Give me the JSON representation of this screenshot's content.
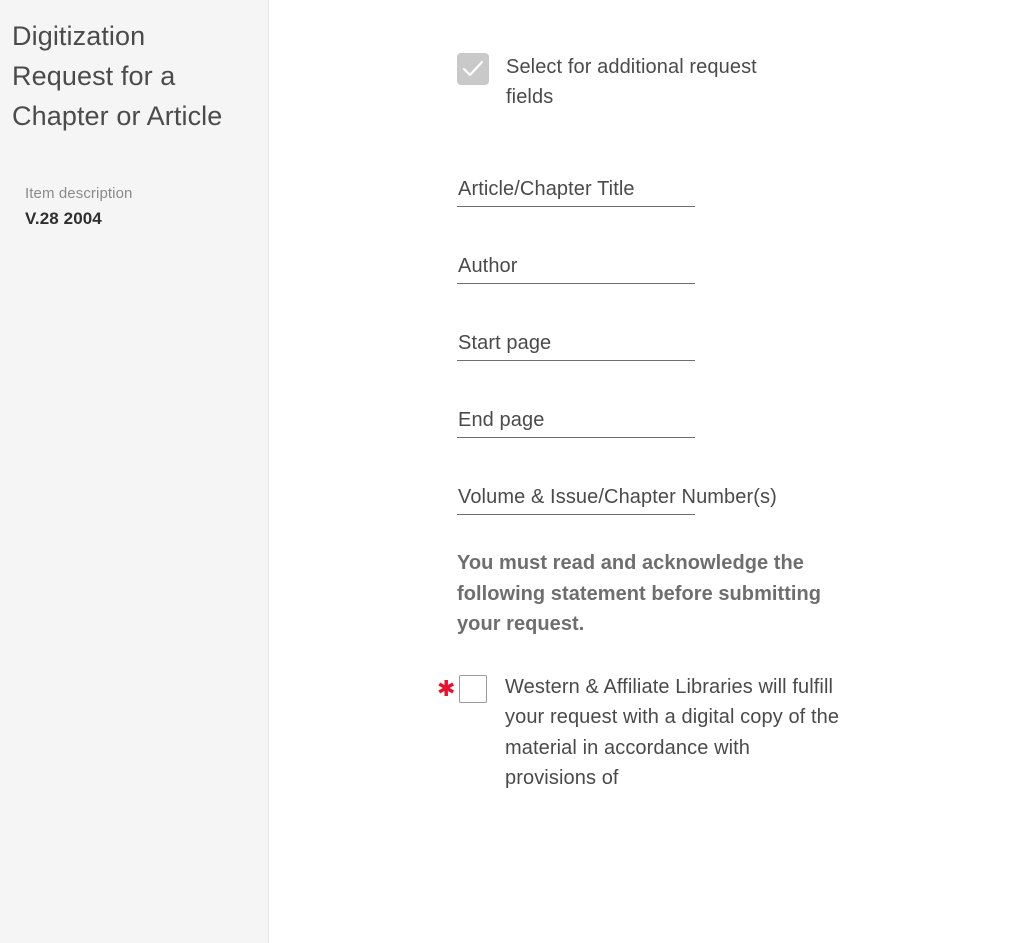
{
  "sidebar": {
    "title": "Digitization Request for a Chapter or Article",
    "item_description_label": "Item description",
    "item_description_value": "V.28 2004"
  },
  "form": {
    "additional_fields_toggle": {
      "label": "Select for additional request fields",
      "checked": true,
      "icon": "check-icon"
    },
    "fields": [
      {
        "name": "article-chapter-title",
        "label": "Article/Chapter Title",
        "value": "",
        "placeholder": "Article/Chapter Title"
      },
      {
        "name": "author",
        "label": "Author",
        "value": "",
        "placeholder": "Author"
      },
      {
        "name": "start-page",
        "label": "Start page",
        "value": "",
        "placeholder": "Start page"
      },
      {
        "name": "end-page",
        "label": "End page",
        "value": "",
        "placeholder": "End page"
      },
      {
        "name": "volume-issue-chapter-number",
        "label": "Volume & Issue/Chapter Number(s)",
        "value": "",
        "placeholder": "Volume & Issue/Chapter Number(s)"
      }
    ],
    "acknowledgement": {
      "heading": "You must read and acknowledge the following statement before submitting your request.",
      "required_marker": "✱",
      "checked": false,
      "statement": "Western & Affiliate Libraries will fulfill your request with a digital copy of the material in accordance with provisions of"
    }
  },
  "colors": {
    "sidebar_background": "#f5f5f6",
    "required_red": "#e8112d",
    "text_primary": "#4a4a4a",
    "text_muted": "#8a8a8a",
    "checkbox_disabled": "#c9c9c9",
    "field_underline": "#6f6f6f"
  }
}
